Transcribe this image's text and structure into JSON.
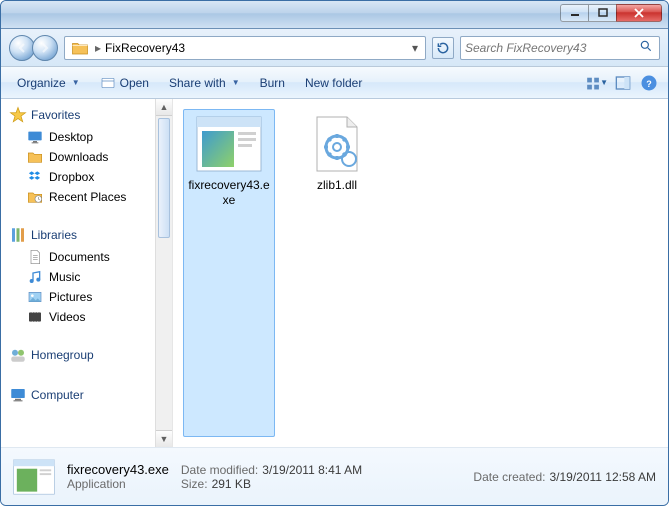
{
  "folder_name": "FixRecovery43",
  "search": {
    "placeholder": "Search FixRecovery43"
  },
  "toolbar": {
    "organize": "Organize",
    "open": "Open",
    "share": "Share with",
    "burn": "Burn",
    "new_folder": "New folder"
  },
  "navpane": {
    "favorites": {
      "label": "Favorites",
      "items": [
        {
          "label": "Desktop"
        },
        {
          "label": "Downloads"
        },
        {
          "label": "Dropbox"
        },
        {
          "label": "Recent Places"
        }
      ]
    },
    "libraries": {
      "label": "Libraries",
      "items": [
        {
          "label": "Documents"
        },
        {
          "label": "Music"
        },
        {
          "label": "Pictures"
        },
        {
          "label": "Videos"
        }
      ]
    },
    "homegroup": {
      "label": "Homegroup"
    },
    "computer": {
      "label": "Computer"
    }
  },
  "files": [
    {
      "name": "fixrecovery43.exe",
      "type": "Application",
      "selected": true
    },
    {
      "name": "zlib1.dll",
      "type": "DLL",
      "selected": false
    }
  ],
  "details": {
    "name": "fixrecovery43.exe",
    "type": "Application",
    "modified_label": "Date modified:",
    "modified_value": "3/19/2011 8:41 AM",
    "size_label": "Size:",
    "size_value": "291 KB",
    "created_label": "Date created:",
    "created_value": "3/19/2011 12:58 AM"
  }
}
